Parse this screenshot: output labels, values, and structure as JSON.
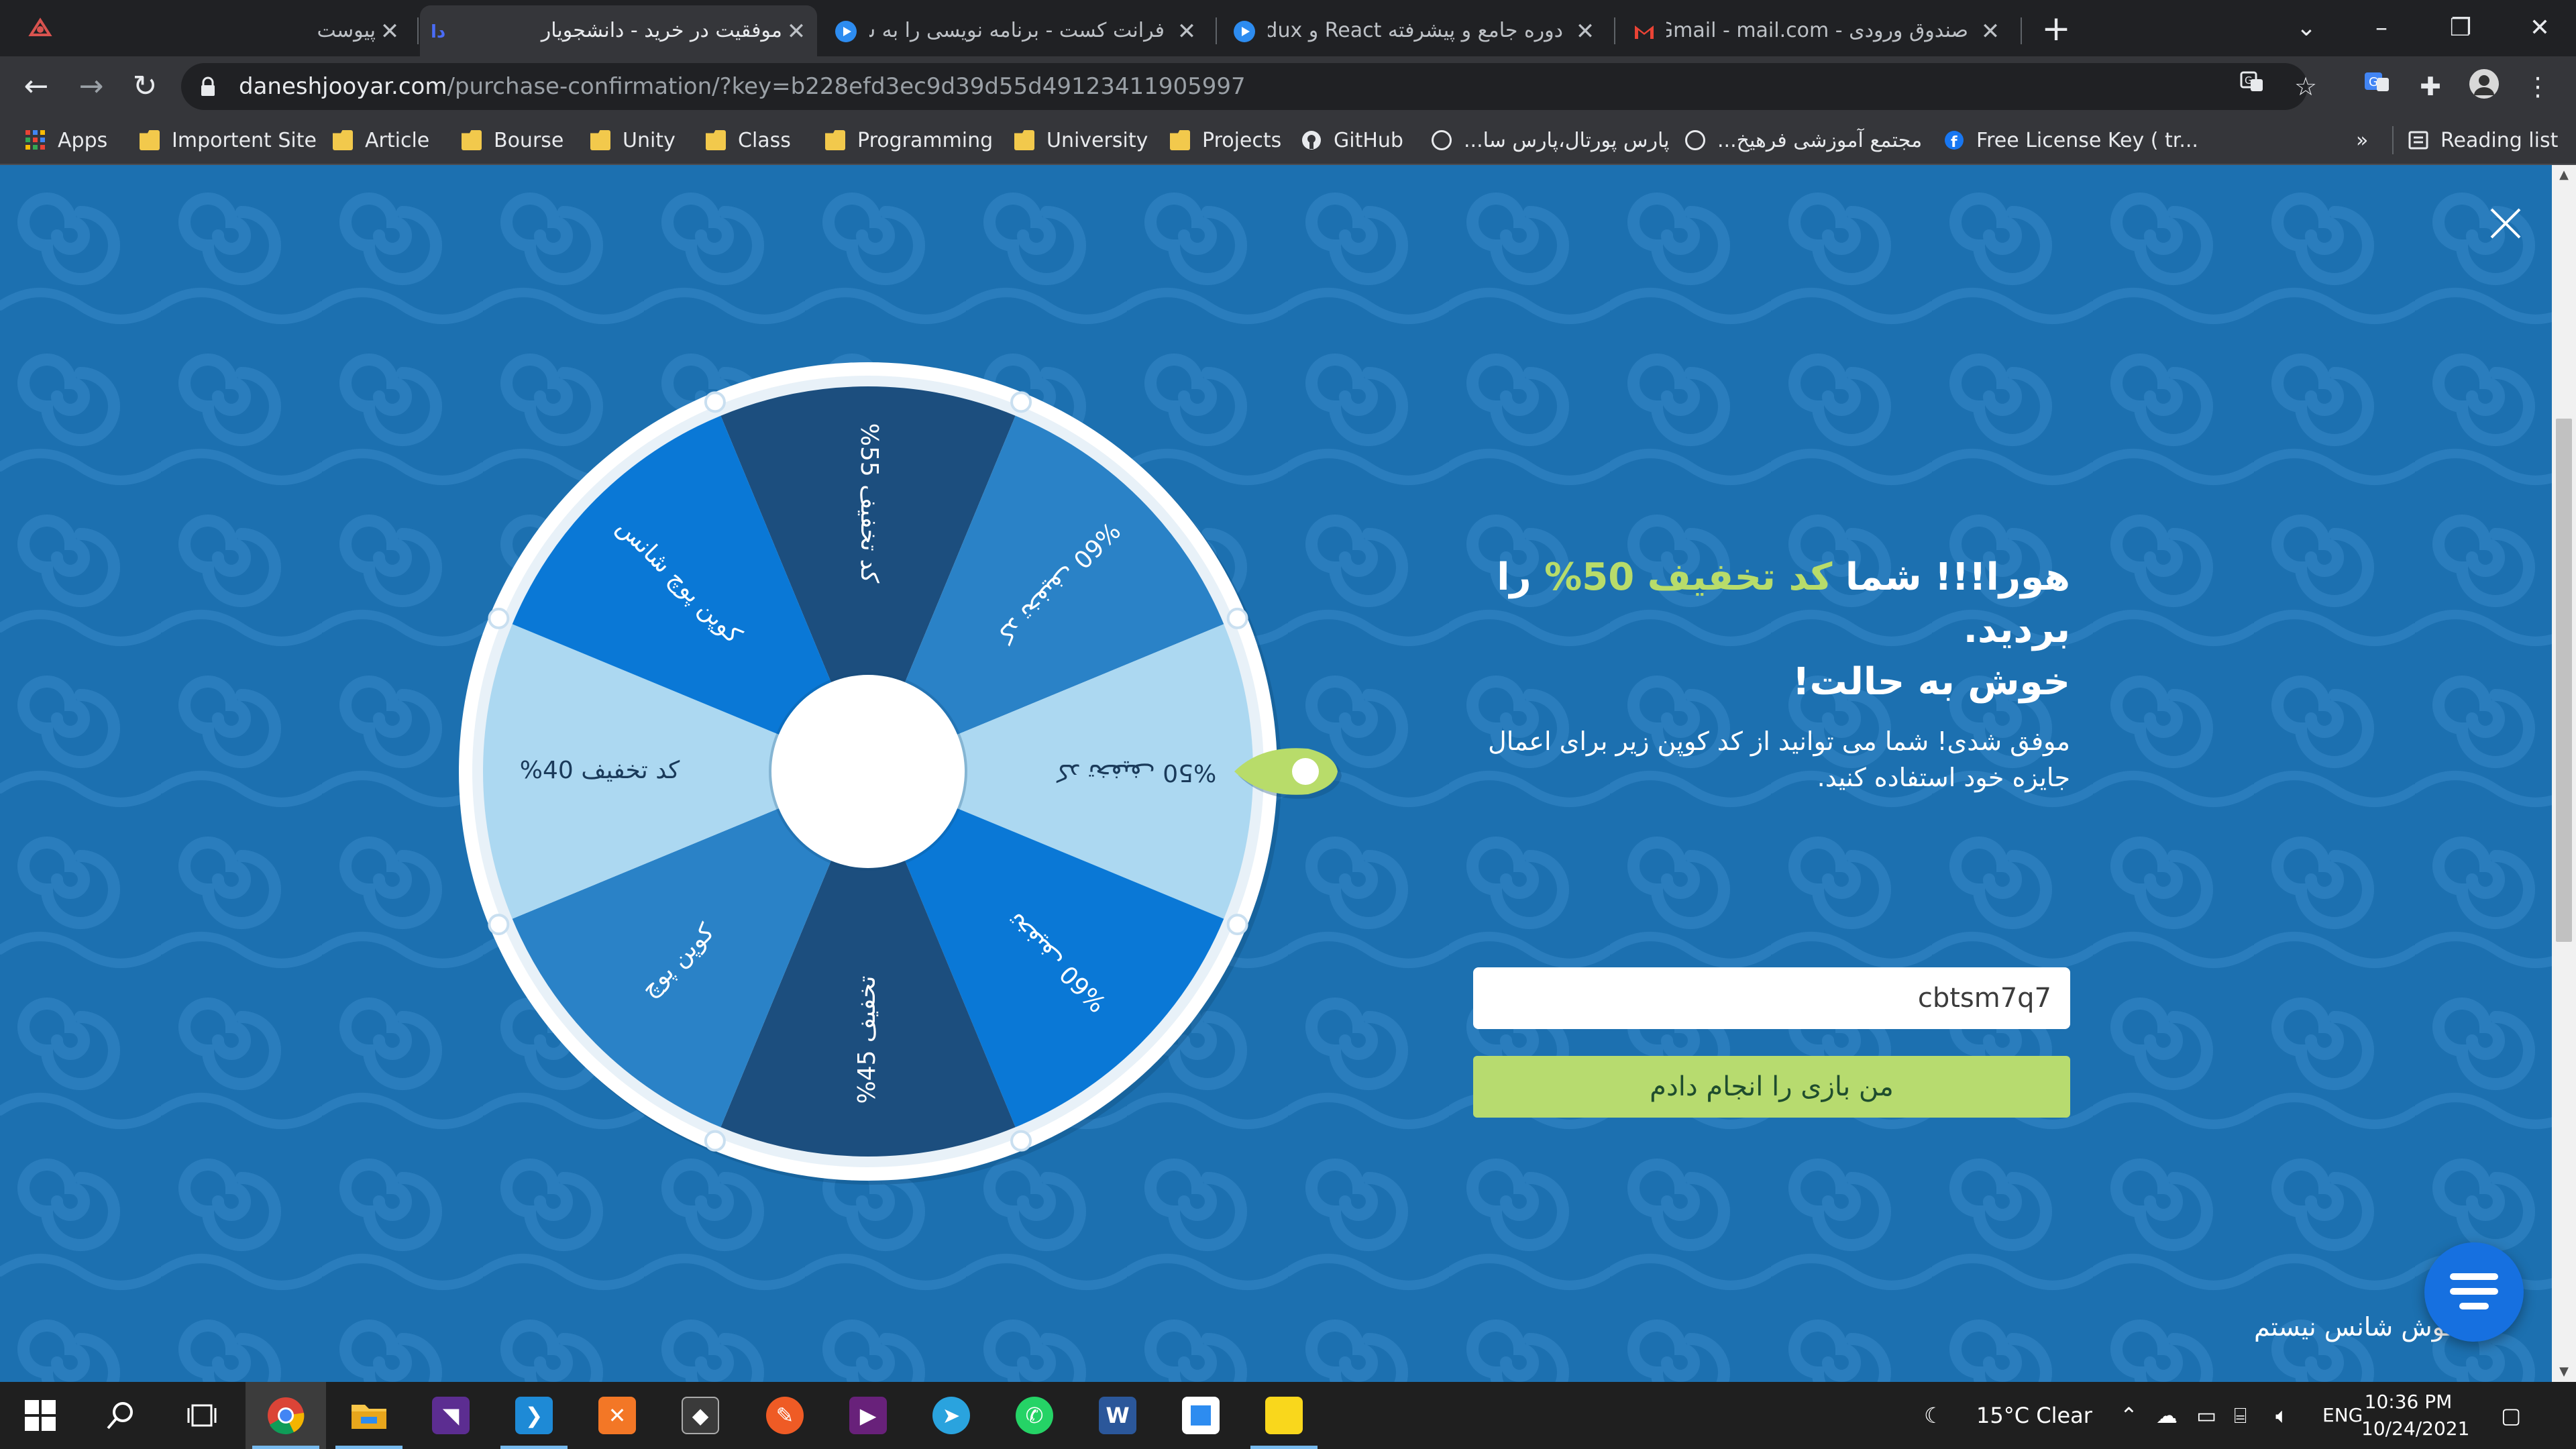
{
  "tabs": [
    {
      "title": "پیوست"
    },
    {
      "title": "موفقیت در خرید - دانشجویار"
    },
    {
      "title": "فرانت کست - برنامه نویسی را به سا"
    },
    {
      "title": "دوره جامع و پیشرفته React و Redux"
    },
    {
      "title": "صندوق ورودی - Gmail - mail.com"
    }
  ],
  "new_tab": "+",
  "address": {
    "host": "daneshjooyar.com",
    "path": "/purchase-confirmation/?key=b228efd3ec9d39d55d49123411905997"
  },
  "bookmarks": [
    {
      "label": "Apps"
    },
    {
      "label": "Importent Site"
    },
    {
      "label": "Article"
    },
    {
      "label": "Bourse"
    },
    {
      "label": "Unity"
    },
    {
      "label": "Class"
    },
    {
      "label": "Programming"
    },
    {
      "label": "University"
    },
    {
      "label": "Projects"
    },
    {
      "label": "GitHub"
    },
    {
      "label": "پارس پورتال،پارس سا..."
    },
    {
      "label": "مجتمع آموزشی فرهیخ..."
    },
    {
      "label": "Free License Key ( tr..."
    },
    {
      "label": "»"
    },
    {
      "label": "Reading list"
    }
  ],
  "wheel": {
    "segments": [
      {
        "label": "کد تخفیف 55%",
        "color": "#1c4e7e"
      },
      {
        "label": "کد تخفیف 60%",
        "color": "#2a82c7"
      },
      {
        "label": "کد تخفیف 50%",
        "color": "#acd8f1"
      },
      {
        "label": "تخفیف 60%",
        "color": "#0a78d6"
      },
      {
        "label": "تخفیف 45%",
        "color": "#1c4e7e"
      },
      {
        "label": "کوپن پوچ",
        "color": "#2a82c7"
      },
      {
        "label": "کد تخفیف 40%",
        "color": "#acd8f1"
      },
      {
        "label": "کوپن پوچ شانس",
        "color": "#0a78d6"
      }
    ],
    "pointer_color": "#b8dc6a"
  },
  "result": {
    "headline_prefix": "هورا!!! شما",
    "highlight": "کد تخفیف 50%",
    "headline_suffix": "را بردید.",
    "headline_line2": "خوش به حالت!",
    "subtext": "موفق شدی! شما می توانید از کد کوپن زیر برای اعمال جایزه خود استفاده کنید.",
    "coupon_code": "cbtsm7q7",
    "played_button": "من بازی را انجام دادم",
    "no_luck_link": "خوش شانس نیستم"
  },
  "colors": {
    "background": "#1c70b0",
    "accent": "#b8dc6a",
    "pattern": "#2a7dbd"
  },
  "taskbar": {
    "weather": "15°C  Clear",
    "language": "ENG",
    "time": "10:36 PM",
    "date": "10/24/2021"
  }
}
